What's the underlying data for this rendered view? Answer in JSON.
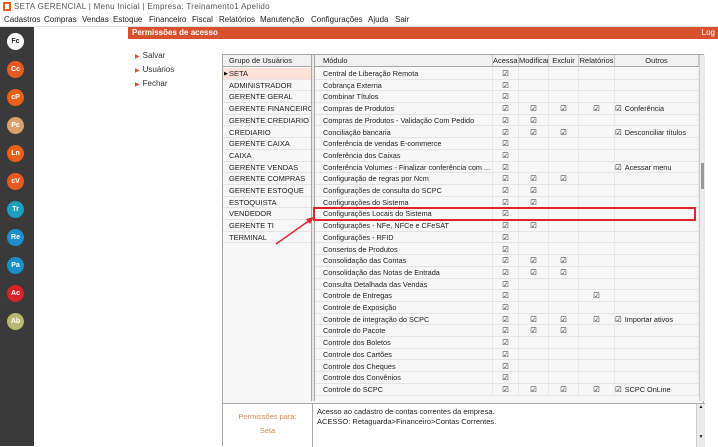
{
  "app": {
    "title": "SETA GERENCIAL | Menu Inicial | Empresa: Treinamento1 Apelido"
  },
  "menu": [
    "Cadastros",
    "Compras",
    "Vendas",
    "Estoque",
    "Financeiro",
    "Fiscal",
    "Relatórios",
    "Manutenção",
    "Configurações",
    "Ajuda",
    "Sair"
  ],
  "shortcuts": [
    {
      "label": "Fc",
      "bg": "#ffffff",
      "fg": "#222222"
    },
    {
      "label": "Cc",
      "bg": "#e85a24",
      "fg": "#ffffff"
    },
    {
      "label": "cP",
      "bg": "#e8601c",
      "fg": "#ffffff"
    },
    {
      "label": "Pc",
      "bg": "#d8a06a",
      "fg": "#ffffff"
    },
    {
      "label": "Ln",
      "bg": "#e8601c",
      "fg": "#ffffff"
    },
    {
      "label": "cV",
      "bg": "#e85a24",
      "fg": "#ffffff"
    },
    {
      "label": "Tr",
      "bg": "#1c9fc0",
      "fg": "#ffffff"
    },
    {
      "label": "Re",
      "bg": "#1c8fc8",
      "fg": "#ffffff"
    },
    {
      "label": "Pa",
      "bg": "#1c8fc8",
      "fg": "#ffffff"
    },
    {
      "label": "Ac",
      "bg": "#d8232a",
      "fg": "#ffffff"
    },
    {
      "label": "Ab",
      "bg": "#b8b870",
      "fg": "#ffffff"
    }
  ],
  "window": {
    "title": "Permissões de acesso",
    "link": "Log"
  },
  "actions": [
    "Salvar",
    "Usuários",
    "Fechar"
  ],
  "groups": {
    "header": "Grupo de Usuários",
    "items": [
      "SETA",
      "ADMINISTRADOR",
      "GERENTE GERAL",
      "GERENTE FINANCEIRO",
      "GERENTE CREDIARIO",
      "CREDIARIO",
      "GERENTE CAIXA",
      "CAIXA",
      "GERENTE VENDAS",
      "GERENTE COMPRAS",
      "GERENTE ESTOQUE",
      "ESTOQUISTA",
      "VENDEDOR",
      "GERENTE TI",
      "TERMINAL"
    ],
    "selected": 0
  },
  "permissions": {
    "headers": [
      "Módulo",
      "Acessar",
      "Modificar",
      "Excluir",
      "Relatórios",
      "Outros"
    ],
    "check": "☑",
    "rows": [
      {
        "m": "Central de Liberação Remota",
        "a": 1,
        "mo": 0,
        "e": 0,
        "r": 0,
        "o": ""
      },
      {
        "m": "Cobrança Externa",
        "a": 1,
        "mo": 0,
        "e": 0,
        "r": 0,
        "o": ""
      },
      {
        "m": "Combinar Títulos",
        "a": 1,
        "mo": 0,
        "e": 0,
        "r": 0,
        "o": ""
      },
      {
        "m": "Compras de Produtos",
        "a": 1,
        "mo": 1,
        "e": 1,
        "r": 1,
        "o": "Conferência"
      },
      {
        "m": "Compras de Produtos - Validação Com Pedido",
        "a": 1,
        "mo": 1,
        "e": 0,
        "r": 0,
        "o": ""
      },
      {
        "m": "Conciliação bancaria",
        "a": 1,
        "mo": 1,
        "e": 1,
        "r": 0,
        "o": "Desconciliar títulos"
      },
      {
        "m": "Conferência de vendas E-commerce",
        "a": 1,
        "mo": 0,
        "e": 0,
        "r": 0,
        "o": ""
      },
      {
        "m": "Conferência dos Caixas",
        "a": 1,
        "mo": 0,
        "e": 0,
        "r": 0,
        "o": ""
      },
      {
        "m": "Conferência Volumes - Finalizar conferência com ...",
        "a": 1,
        "mo": 0,
        "e": 0,
        "r": 0,
        "o": "Acessar menu"
      },
      {
        "m": "Configuração de regras por Ncm",
        "a": 1,
        "mo": 1,
        "e": 1,
        "r": 0,
        "o": ""
      },
      {
        "m": "Configurações de consulta do SCPC",
        "a": 1,
        "mo": 1,
        "e": 0,
        "r": 0,
        "o": ""
      },
      {
        "m": "Configurações do Sistema",
        "a": 1,
        "mo": 1,
        "e": 0,
        "r": 0,
        "o": ""
      },
      {
        "m": "Configurações Locais do Sistema",
        "a": 1,
        "mo": 0,
        "e": 0,
        "r": 0,
        "o": ""
      },
      {
        "m": "Configurações - NFe, NFCe e CFeSAT",
        "a": 1,
        "mo": 1,
        "e": 0,
        "r": 0,
        "o": ""
      },
      {
        "m": "Configurações - RFID",
        "a": 1,
        "mo": 0,
        "e": 0,
        "r": 0,
        "o": ""
      },
      {
        "m": "Consertos de Produtos",
        "a": 1,
        "mo": 0,
        "e": 0,
        "r": 0,
        "o": ""
      },
      {
        "m": "Consolidação das Contas",
        "a": 1,
        "mo": 1,
        "e": 1,
        "r": 0,
        "o": ""
      },
      {
        "m": "Consolidação das Notas de Entrada",
        "a": 1,
        "mo": 1,
        "e": 1,
        "r": 0,
        "o": ""
      },
      {
        "m": "Consulta Detalhada das Vendas",
        "a": 1,
        "mo": 0,
        "e": 0,
        "r": 0,
        "o": ""
      },
      {
        "m": "Controle de Entregas",
        "a": 1,
        "mo": 0,
        "e": 0,
        "r": 1,
        "o": ""
      },
      {
        "m": "Controle de Exposição",
        "a": 1,
        "mo": 0,
        "e": 0,
        "r": 0,
        "o": ""
      },
      {
        "m": "Controle de integração do SCPC",
        "a": 1,
        "mo": 1,
        "e": 1,
        "r": 1,
        "o": "Importar ativos"
      },
      {
        "m": "Controle do Pacote",
        "a": 1,
        "mo": 1,
        "e": 1,
        "r": 0,
        "o": ""
      },
      {
        "m": "Controle dos Boletos",
        "a": 1,
        "mo": 0,
        "e": 0,
        "r": 0,
        "o": ""
      },
      {
        "m": "Controle dos Cartões",
        "a": 1,
        "mo": 0,
        "e": 0,
        "r": 0,
        "o": ""
      },
      {
        "m": "Controle dos Cheques",
        "a": 1,
        "mo": 0,
        "e": 0,
        "r": 0,
        "o": ""
      },
      {
        "m": "Controle dos Convênios",
        "a": 1,
        "mo": 0,
        "e": 0,
        "r": 0,
        "o": ""
      },
      {
        "m": "Controle do SCPC",
        "a": 1,
        "mo": 1,
        "e": 1,
        "r": 1,
        "o": "SCPC OnLine"
      }
    ]
  },
  "bottom": {
    "label": "Permissões para:",
    "group": "Seta",
    "line1": "Acesso ao cadastro de contas correntes da empresa.",
    "line2": "ACESSO: Retaguarda>Financeiro>Contas Correntes."
  }
}
